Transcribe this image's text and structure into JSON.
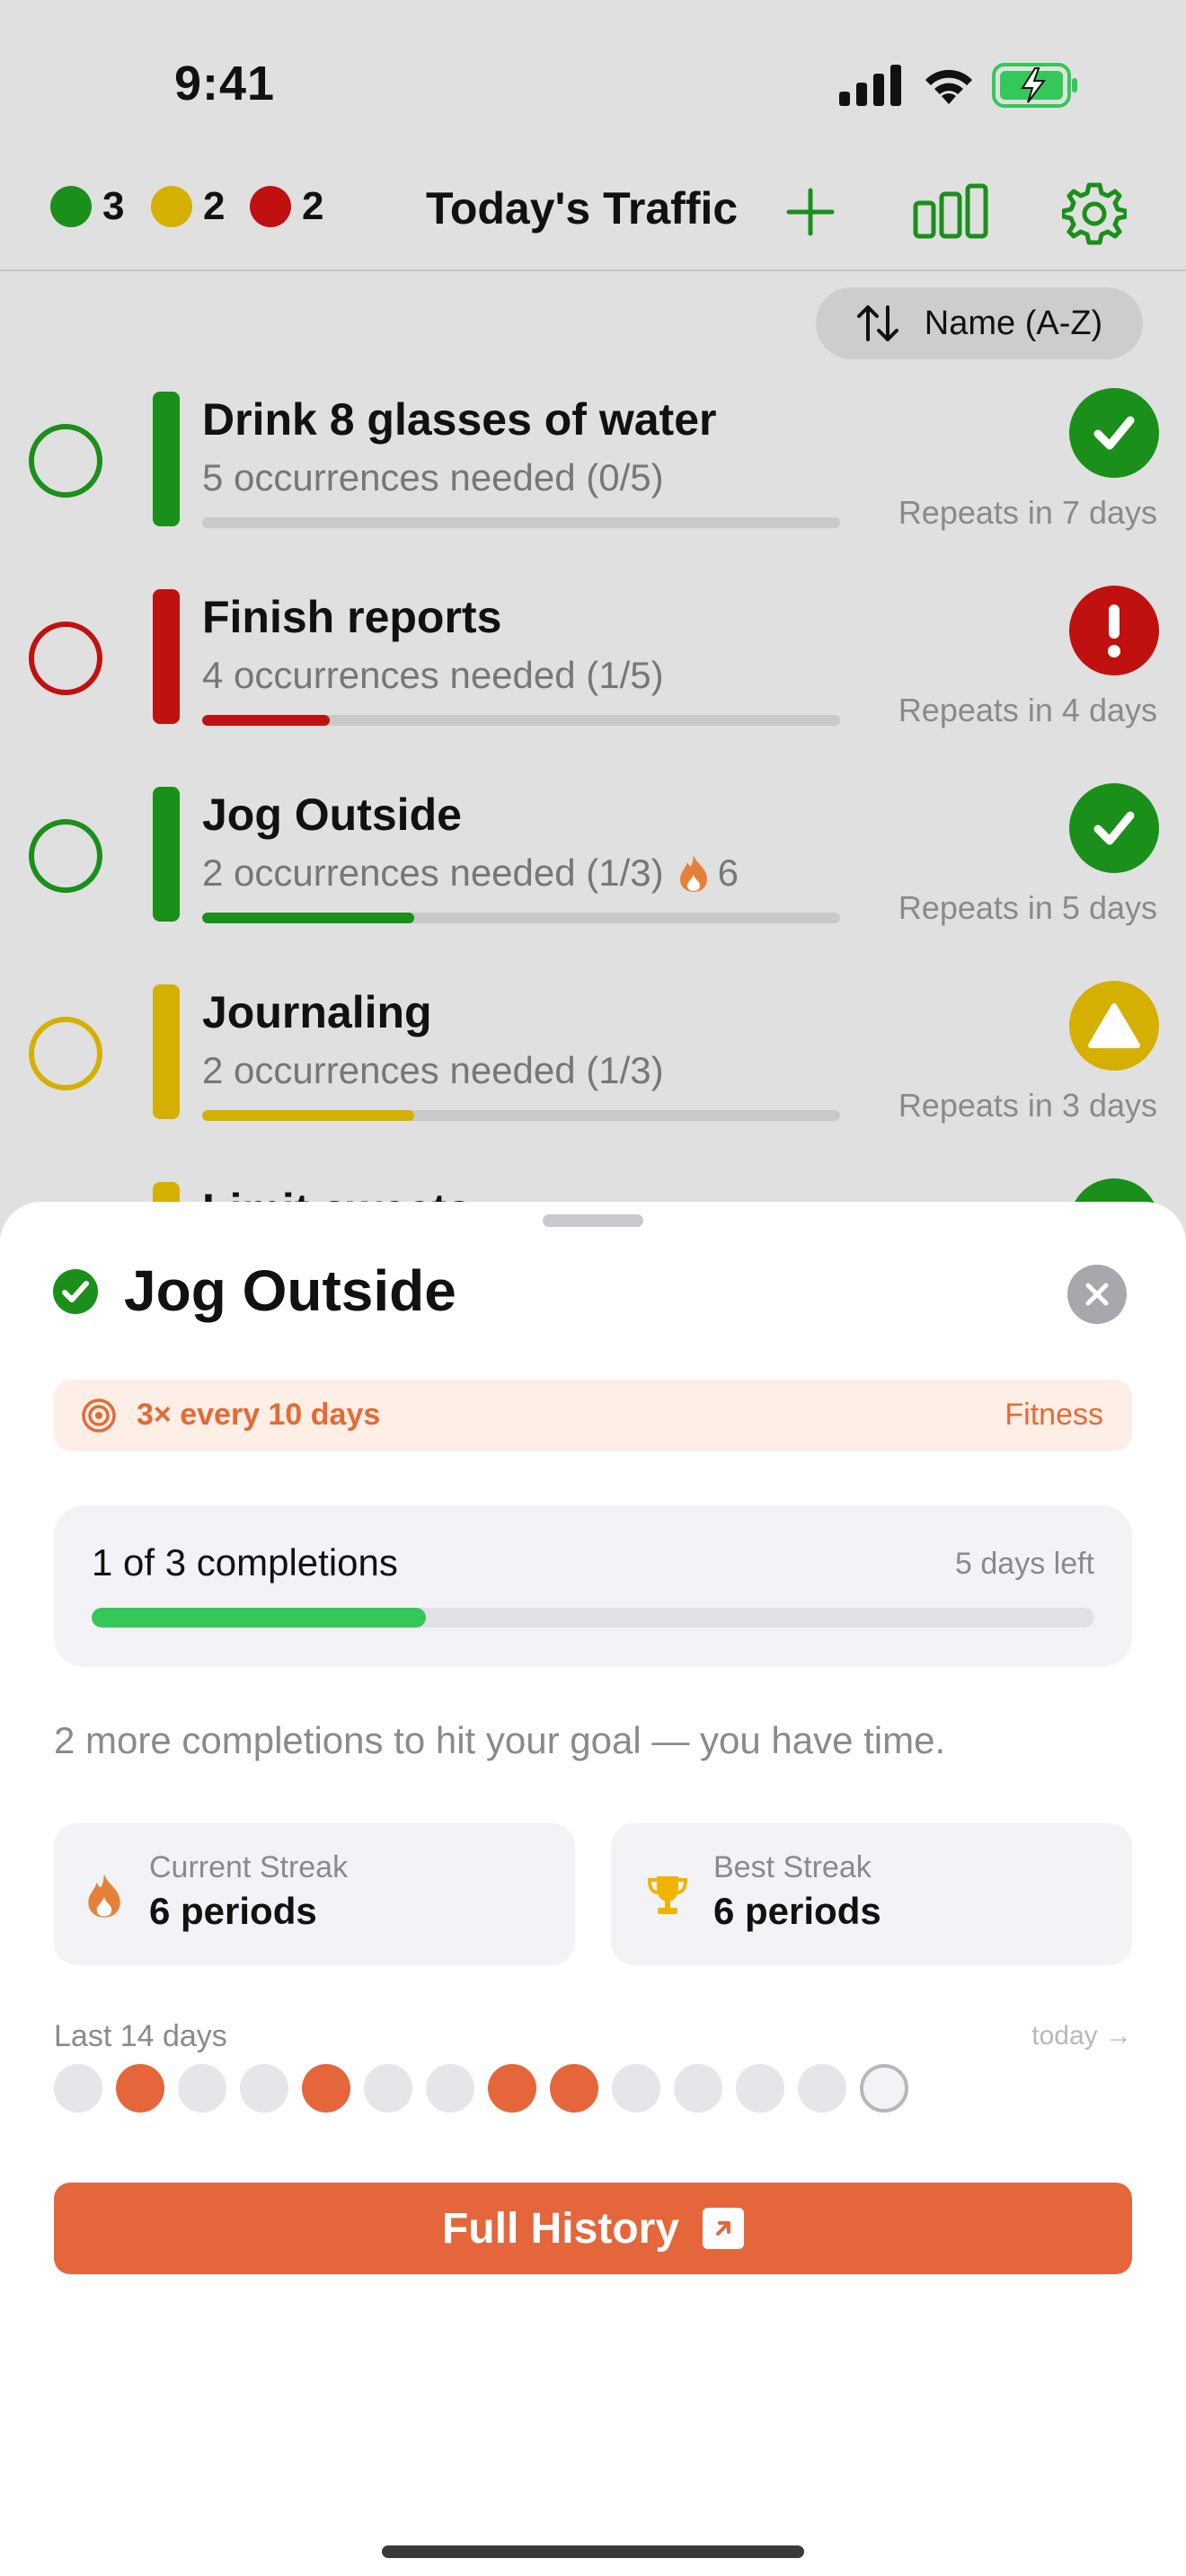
{
  "status_bar": {
    "time": "9:41"
  },
  "header": {
    "counts": [
      {
        "value": "3",
        "color": "#1a8f1a"
      },
      {
        "value": "2",
        "color": "#d4b000"
      },
      {
        "value": "2",
        "color": "#c01010"
      }
    ],
    "title": "Today's Traffic"
  },
  "sort": {
    "label": "Name (A-Z)"
  },
  "habits": [
    {
      "title": "Drink 8 glasses of water",
      "subtitle": "5 occurrences needed (0/5)",
      "progress": 0.0,
      "color": "#1a8f1a",
      "status": "check",
      "repeats": "Repeats in 7 days"
    },
    {
      "title": "Finish reports",
      "subtitle": "4 occurrences needed (1/5)",
      "progress": 0.2,
      "color": "#c01010",
      "status": "exclamation",
      "repeats": "Repeats in 4 days"
    },
    {
      "title": "Jog Outside",
      "subtitle": "2 occurrences needed (1/3)",
      "streak": "6",
      "progress": 0.333,
      "color": "#1a8f1a",
      "status": "check",
      "repeats": "Repeats in 5 days"
    },
    {
      "title": "Journaling",
      "subtitle": "2 occurrences needed (1/3)",
      "progress": 0.333,
      "color": "#d4b000",
      "status": "triangle",
      "repeats": "Repeats in 3 days"
    },
    {
      "title": "Limit sweets",
      "color": "#d4b000",
      "status": "check"
    }
  ],
  "sheet": {
    "title": "Jog Outside",
    "goal": "3× every 10 days",
    "category": "Fitness",
    "progress_label": "1 of 3 completions",
    "days_left": "5 days left",
    "progress": 0.333,
    "hint": "2 more completions to hit your goal — you have time.",
    "current_streak_label": "Current Streak",
    "current_streak_value": "6 periods",
    "best_streak_label": "Best Streak",
    "best_streak_value": "6 periods",
    "last_days_label": "Last 14 days",
    "today_label": "today →",
    "days": [
      0,
      1,
      0,
      0,
      1,
      0,
      0,
      1,
      1,
      0,
      0,
      0,
      0,
      0
    ],
    "button_label": "Full History",
    "accent": "#e5663a"
  }
}
